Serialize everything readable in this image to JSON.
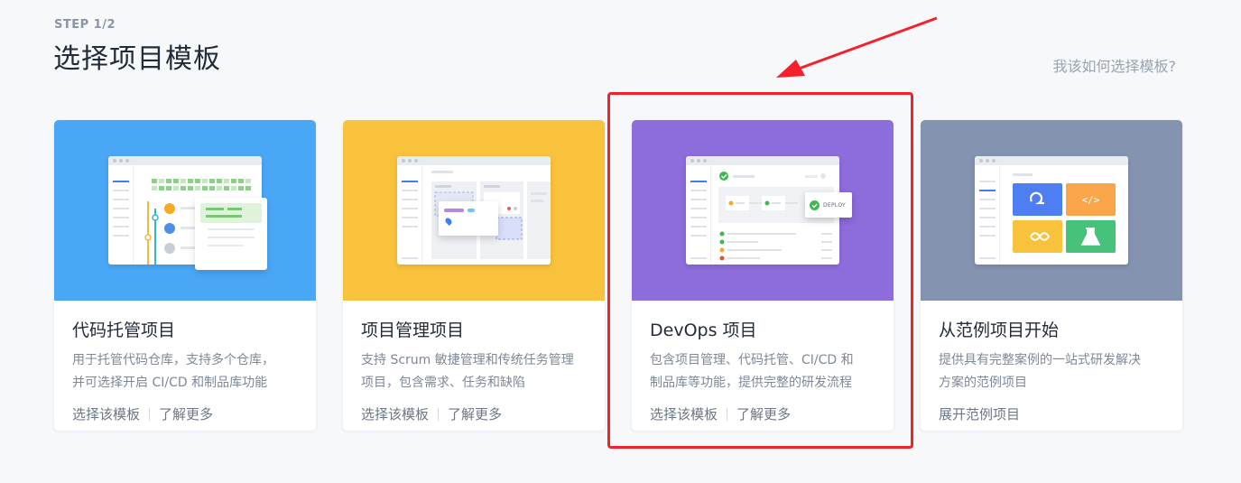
{
  "header": {
    "step": "STEP 1/2",
    "title": "选择项目模板",
    "help_link": "我该如何选择模板?"
  },
  "cards": [
    {
      "title": "代码托管项目",
      "desc_line1": "用于托管代码仓库，支持多个仓库，",
      "desc_line2": "并可选择开启 CI/CD 和制品库功能",
      "action1": "选择该模板",
      "action2": "了解更多",
      "color": "#4aa7f5"
    },
    {
      "title": "项目管理项目",
      "desc_line1": "支持 Scrum 敏捷管理和传统任务管理",
      "desc_line2": "项目，包含需求、任务和缺陷",
      "action1": "选择该模板",
      "action2": "了解更多",
      "color": "#f9c23c"
    },
    {
      "title": "DevOps 项目",
      "desc_line1": "包含项目管理、代码托管、CI/CD 和",
      "desc_line2": "制品库等功能，提供完整的研发流程",
      "action1": "选择该模板",
      "action2": "了解更多",
      "color": "#8d6cdb",
      "deploy_label": "DEPLOY"
    },
    {
      "title": "从范例项目开始",
      "desc_line1": "提供具有完整案例的一站式研发解决",
      "desc_line2": "方案的范例项目",
      "action1": "展开范例项目",
      "color": "#8393b0"
    }
  ],
  "colors": {
    "highlight": "#f5202a"
  }
}
